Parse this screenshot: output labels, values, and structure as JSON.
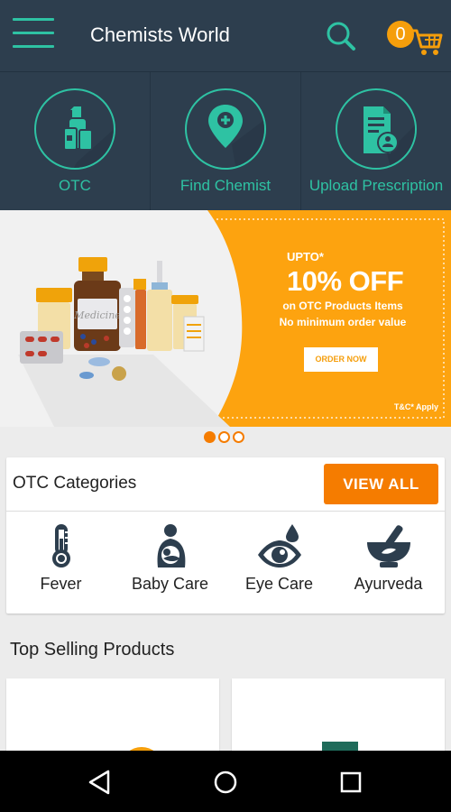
{
  "app_title": "Chemists World",
  "cart": {
    "count": "0"
  },
  "quick_actions": [
    {
      "label": "OTC",
      "icon": "otc-bottles-icon"
    },
    {
      "label": "Find Chemist",
      "icon": "map-pin-icon"
    },
    {
      "label": "Upload Prescription",
      "icon": "prescription-upload-icon"
    }
  ],
  "banner": {
    "upto": "UPTO*",
    "offer": "10% OFF",
    "line1": "on OTC Products Items",
    "line2": "No minimum order value",
    "cta": "ORDER NOW",
    "terms": "T&C* Apply",
    "bottle_label": "Medicine"
  },
  "carousel": {
    "slides": 3,
    "active": 0
  },
  "otc_categories": {
    "title": "OTC Categories",
    "view_all": "VIEW ALL",
    "items": [
      {
        "label": "Fever",
        "icon": "thermometer-icon"
      },
      {
        "label": "Baby Care",
        "icon": "mother-baby-icon"
      },
      {
        "label": "Eye Care",
        "icon": "eye-drop-icon"
      },
      {
        "label": "Ayurveda",
        "icon": "mortar-pestle-icon"
      }
    ]
  },
  "top_selling": {
    "title": "Top Selling Products"
  },
  "colors": {
    "header": "#2d3e4e",
    "accent": "#2ec2a3",
    "orange": "#f57c00",
    "banner_orange": "#fda30f"
  }
}
